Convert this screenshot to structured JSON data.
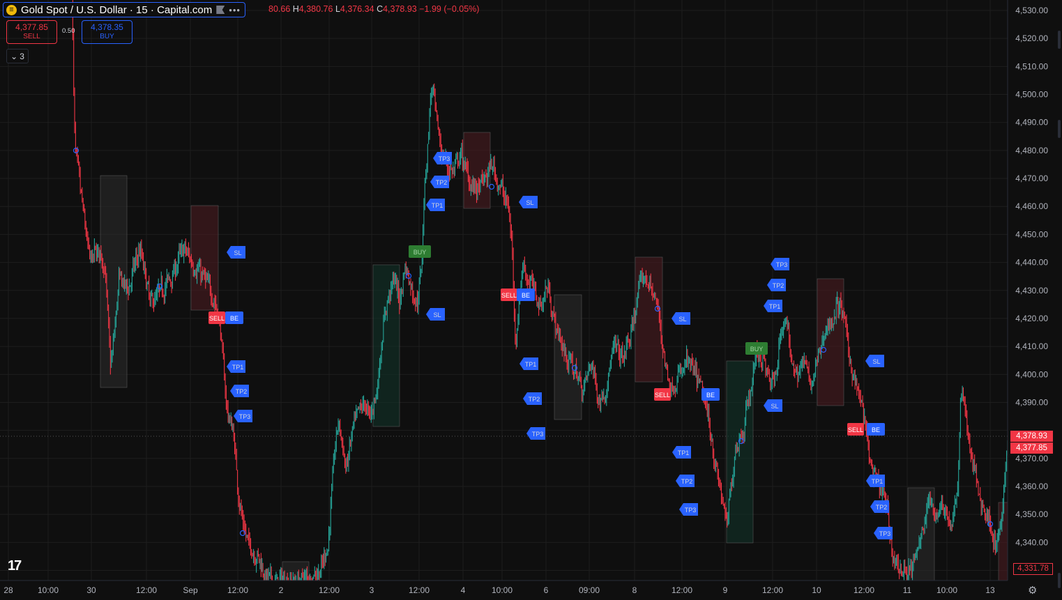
{
  "symbol": {
    "title": "Gold Spot / U.S. Dollar · 15 · Capital.com",
    "icon": "gold-coin-icon",
    "more": "•••"
  },
  "ohlc": {
    "open_value": "80.66",
    "h_key": "H",
    "h_value": "4,380.76",
    "l_key": "L",
    "l_value": "4,376.34",
    "c_key": "C",
    "c_value": "4,378.93",
    "change": "−1.99 (−0.05%)"
  },
  "trade": {
    "sell_price": "4,377.85",
    "sell_label": "SELL",
    "spread": "0.50",
    "buy_price": "4,378.35",
    "buy_label": "BUY"
  },
  "indicator_toggle": {
    "icon": "chevron-down-icon",
    "count": "3"
  },
  "price_axis": {
    "labels": [
      "4,530.00",
      "4,520.00",
      "4,510.00",
      "4,500.00",
      "4,490.00",
      "4,480.00",
      "4,470.00",
      "4,460.00",
      "4,450.00",
      "4,440.00",
      "4,430.00",
      "4,420.00",
      "4,410.00",
      "4,400.00",
      "4,390.00",
      "4,370.00",
      "4,360.00",
      "4,350.00",
      "4,340.00"
    ],
    "last_price": "4,378.93",
    "bid_price": "4,377.85",
    "low_marker": "4,331.78"
  },
  "time_axis": {
    "labels": [
      "28",
      "10:00",
      "30",
      "12:00",
      "Sep",
      "12:00",
      "2",
      "12:00",
      "3",
      "12:00",
      "4",
      "10:00",
      "6",
      "09:00",
      "8",
      "12:00",
      "9",
      "12:00",
      "10",
      "12:00",
      "11",
      "10:00",
      "13"
    ]
  },
  "signals": {
    "buy": "BUY",
    "sell": "SELL",
    "be": "BE",
    "tp1": "TP1",
    "tp2": "TP2",
    "tp3": "TP3",
    "sl": "SL"
  },
  "colors": {
    "background": "#0f0f0f",
    "bull": "#26a69a",
    "bear": "#f23645",
    "accent": "#2962ff"
  },
  "icons": {
    "logo": "tradingview-logo",
    "settings": "settings-icon",
    "flag": "flag-icon"
  }
}
